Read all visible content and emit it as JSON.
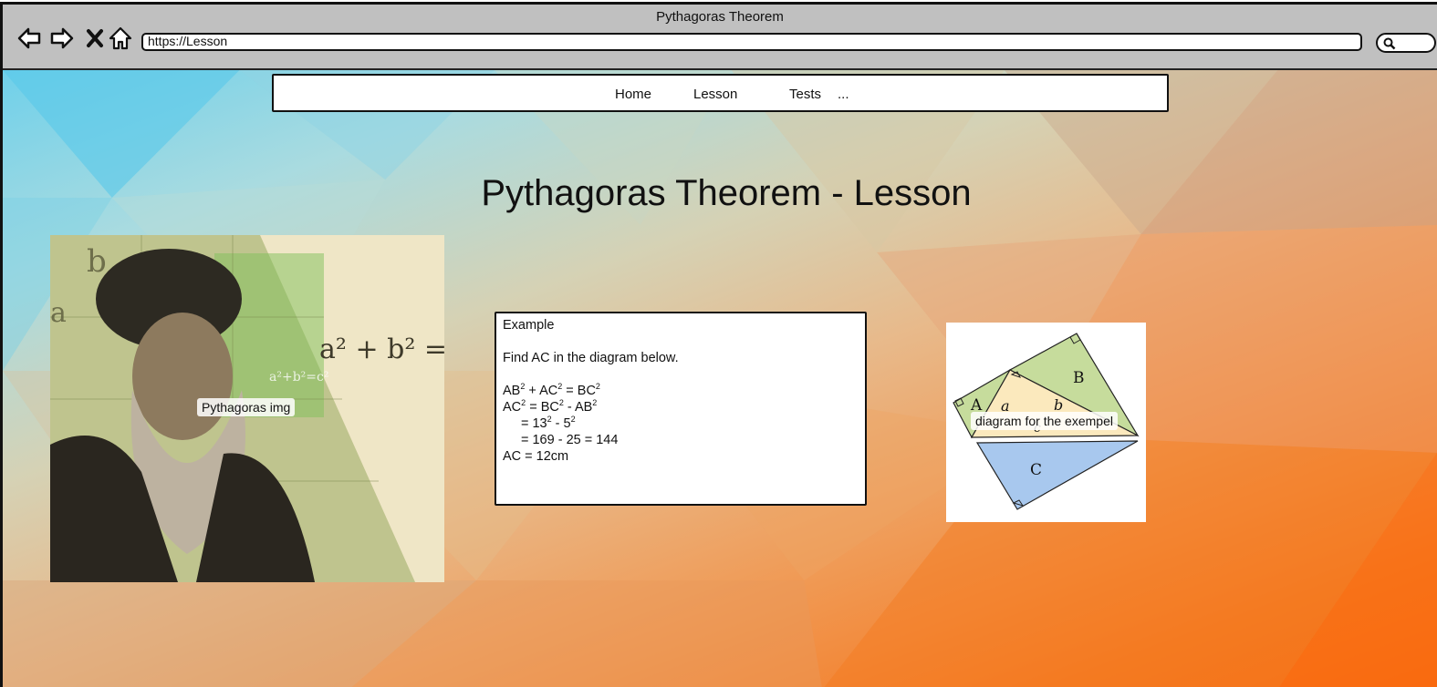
{
  "browser": {
    "title": "Pythagoras Theorem",
    "address": "https://Lesson"
  },
  "nav": {
    "items": [
      {
        "label": "Home"
      },
      {
        "label": "Lesson"
      },
      {
        "label": "Tests"
      },
      {
        "label": "..."
      }
    ]
  },
  "page": {
    "title": "Pythagoras Theorem - Lesson"
  },
  "portrait": {
    "label": "Pythagoras img"
  },
  "example": {
    "heading": "Example",
    "prompt": "Find AC in the diagram below.",
    "line1": {
      "a": "AB",
      "b": " + AC",
      "c": " = BC",
      "sup": "2"
    },
    "line2": {
      "a": "AC",
      "b": " = BC",
      "c": " - AB",
      "sup": "2"
    },
    "line3": {
      "a": "= 13",
      "b": " - 5",
      "sup": "2"
    },
    "line4": "= 169 - 25 = 144",
    "line5": "AC  = 12cm"
  },
  "diagram": {
    "label": "diagram for the exempel",
    "letters": {
      "A": "A",
      "B": "B",
      "C": "C",
      "a": "a",
      "b": "b",
      "c": "c"
    }
  },
  "colors": {
    "chrome": "#c0c0c0",
    "triangle_green": "#c6dc9c",
    "triangle_yellow": "#fbe9bd",
    "triangle_blue": "#a8c8ee"
  }
}
